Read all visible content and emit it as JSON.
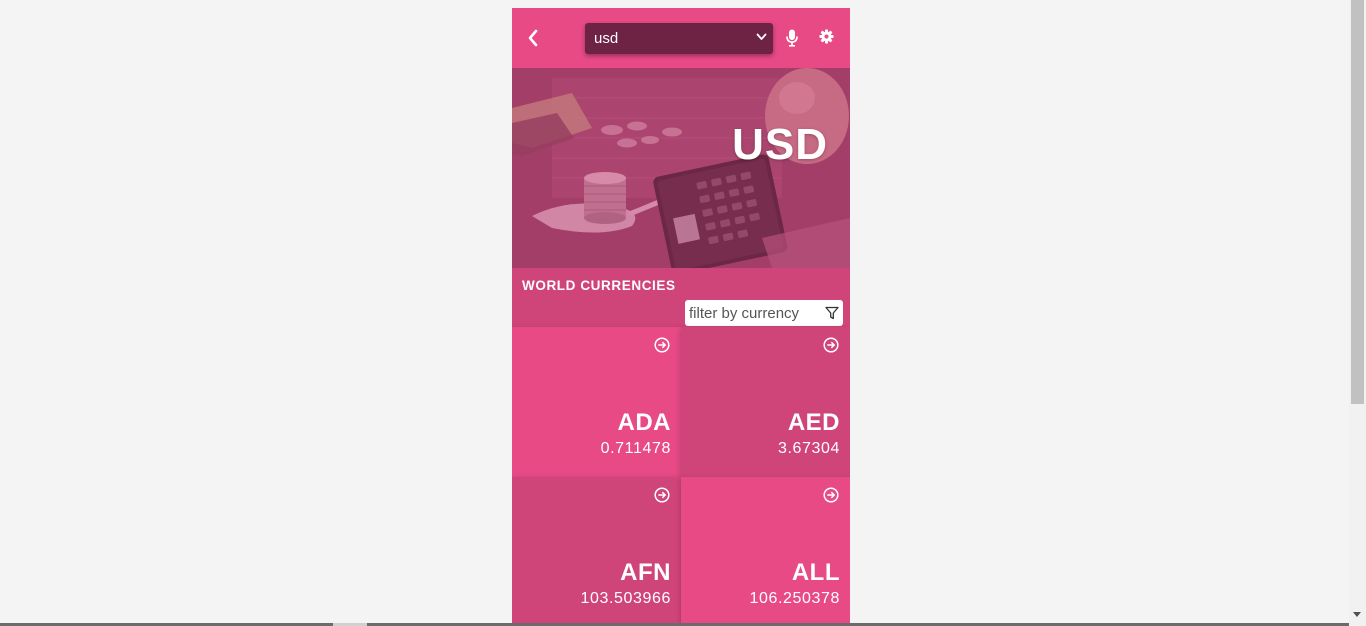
{
  "topbar": {
    "back_icon": "chevron-left-icon",
    "currency_select": {
      "value": "usd",
      "options": [
        "usd"
      ]
    },
    "mic_icon": "microphone-icon",
    "settings_icon": "gear-icon"
  },
  "hero": {
    "title": "USD",
    "image": "coins-calculator-photo"
  },
  "section": {
    "title": "WORLD CURRENCIES",
    "filter_placeholder": "filter by currency",
    "filter_value": "",
    "filter_icon": "funnel-icon"
  },
  "cards": [
    {
      "code": "ADA",
      "rate": "0.711478",
      "icon": "arrow-right-circle-icon"
    },
    {
      "code": "AED",
      "rate": "3.67304",
      "icon": "arrow-right-circle-icon"
    },
    {
      "code": "AFN",
      "rate": "103.503966",
      "icon": "arrow-right-circle-icon"
    },
    {
      "code": "ALL",
      "rate": "106.250378",
      "icon": "arrow-right-circle-icon"
    }
  ],
  "colors": {
    "accent": "#e84a86",
    "accent_dark": "#d04579",
    "select_bg": "#6e2244",
    "page_bg": "#f4f4f4"
  }
}
